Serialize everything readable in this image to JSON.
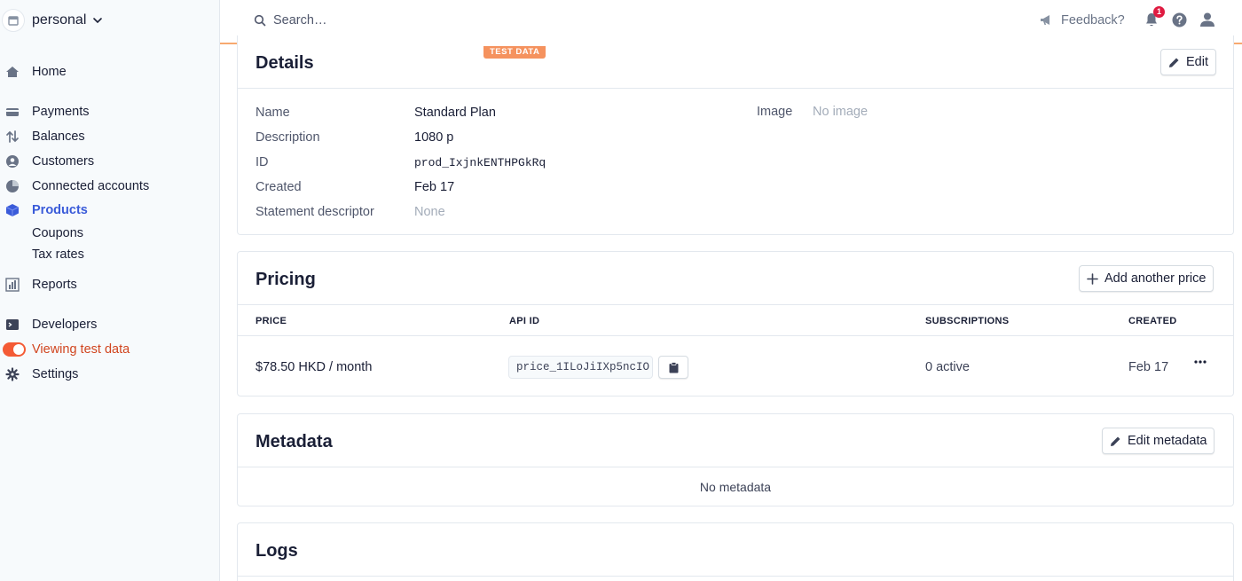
{
  "account": {
    "name": "personal"
  },
  "sidebar": {
    "items": [
      {
        "label": "Home",
        "icon": "home-icon"
      },
      {
        "label": "Payments",
        "icon": "payments-icon"
      },
      {
        "label": "Balances",
        "icon": "balances-icon"
      },
      {
        "label": "Customers",
        "icon": "customers-icon"
      },
      {
        "label": "Connected accounts",
        "icon": "connected-accounts-icon"
      },
      {
        "label": "Products",
        "icon": "products-icon",
        "active": true
      },
      {
        "label": "Coupons"
      },
      {
        "label": "Tax rates"
      },
      {
        "label": "Reports",
        "icon": "reports-icon"
      },
      {
        "label": "Developers",
        "icon": "developers-icon"
      },
      {
        "label": "Viewing test data",
        "icon": "toggle-icon"
      },
      {
        "label": "Settings",
        "icon": "gear-icon"
      }
    ]
  },
  "topbar": {
    "search_placeholder": "Search…",
    "feedback_label": "Feedback?",
    "notification_count": "1",
    "test_badge": "TEST DATA"
  },
  "details": {
    "title": "Details",
    "edit_label": "Edit",
    "fields": [
      {
        "label": "Name",
        "value": "Standard Plan"
      },
      {
        "label": "Description",
        "value": "1080 p"
      },
      {
        "label": "ID",
        "value": "prod_IxjnkENTHPGkRq"
      },
      {
        "label": "Created",
        "value": "Feb 17"
      },
      {
        "label": "Statement descriptor",
        "value": "None"
      }
    ],
    "image_label": "Image",
    "image_value": "No image"
  },
  "pricing": {
    "title": "Pricing",
    "add_price_label": "Add another price",
    "columns": [
      "PRICE",
      "API ID",
      "SUBSCRIPTIONS",
      "CREATED"
    ],
    "rows": [
      {
        "price": "$78.50 HKD / month",
        "api_id": "price_1ILoJiIXp5ncIO",
        "subscriptions": "0 active",
        "created": "Feb 17"
      }
    ]
  },
  "metadata": {
    "title": "Metadata",
    "edit_label": "Edit metadata",
    "empty_text": "No metadata"
  },
  "logs": {
    "title": "Logs"
  },
  "colors": {
    "accent": "#3a5bd9",
    "test_orange": "#f5925e",
    "test_red": "#d1451f",
    "badge_red": "#df1b41"
  }
}
